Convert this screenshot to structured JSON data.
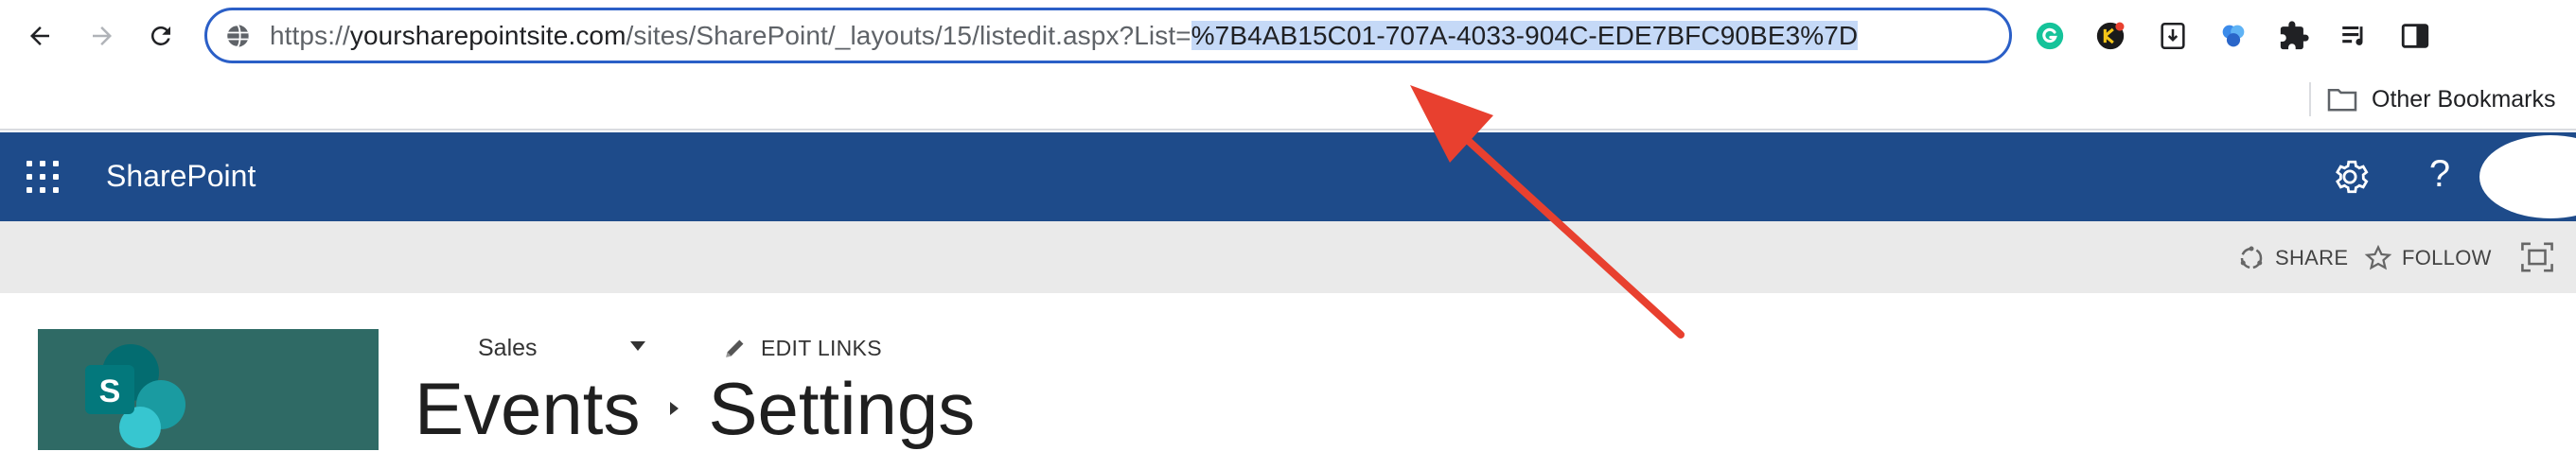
{
  "browser": {
    "url": {
      "prefix": "https://",
      "host": "yoursharepointsite.com",
      "path": "/sites/SharePoint/_layouts/15/listedit.aspx?List=",
      "selected": "%7B4AB15C01-707A-4033-904C-EDE7BFC90BE3%7D"
    },
    "nav_icons": [
      "back-arrow-icon",
      "forward-arrow-icon",
      "reload-icon"
    ],
    "extensions": [
      "grammarly-icon",
      "keeper-icon",
      "extension-icon",
      "copilot-icon",
      "puzzle-icon",
      "media-queue-icon",
      "side-panel-icon"
    ],
    "bookmarks": {
      "other_label": "Other Bookmarks"
    }
  },
  "suite_bar": {
    "brand": "SharePoint",
    "accent": "#1e4b8a"
  },
  "actions": {
    "share_label": "SHARE",
    "follow_label": "FOLLOW"
  },
  "page": {
    "site_nav_label": "Sales",
    "edit_links_label": "EDIT LINKS",
    "breadcrumb": [
      "Events",
      "Settings"
    ],
    "logo_letter": "S"
  },
  "annotation": {
    "arrow_color": "#e8402f"
  },
  "colors": {
    "selection": "#c5d9f7",
    "omnibox_border": "#2b5fc7",
    "logo_bg": "#2f6a65"
  }
}
